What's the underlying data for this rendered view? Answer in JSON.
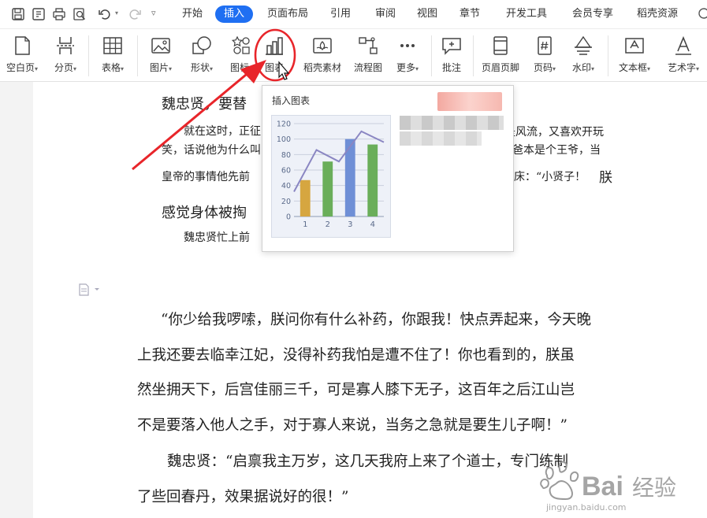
{
  "menubar": {
    "tabs": [
      {
        "label": "开始",
        "active": false
      },
      {
        "label": "插入",
        "active": true
      },
      {
        "label": "页面布局",
        "active": false
      },
      {
        "label": "引用",
        "active": false
      },
      {
        "label": "审阅",
        "active": false
      },
      {
        "label": "视图",
        "active": false
      },
      {
        "label": "章节",
        "active": false
      },
      {
        "label": "开发工具",
        "active": false
      },
      {
        "label": "会员专享",
        "active": false
      },
      {
        "label": "稻壳资源",
        "active": false
      }
    ],
    "quick_icons": [
      "save-icon",
      "export-pdf-icon",
      "print-icon",
      "print-preview-icon",
      "undo-icon",
      "redo-icon",
      "customize-icon"
    ]
  },
  "ribbon": {
    "tools": [
      {
        "label": "空白页",
        "icon": "blank-page-icon",
        "dropdown": true
      },
      {
        "label": "分页",
        "icon": "page-break-icon",
        "dropdown": true
      },
      {
        "label": "表格",
        "icon": "table-icon",
        "dropdown": true
      },
      {
        "label": "图片",
        "icon": "picture-icon",
        "dropdown": true
      },
      {
        "label": "形状",
        "icon": "shape-icon",
        "dropdown": true
      },
      {
        "label": "图标",
        "icon": "icons-icon",
        "dropdown": true
      },
      {
        "label": "图表",
        "icon": "chart-icon",
        "dropdown": false,
        "highlighted": true
      },
      {
        "label": "稻壳素材",
        "icon": "material-icon",
        "dropdown": false
      },
      {
        "label": "流程图",
        "icon": "flowchart-icon",
        "dropdown": false
      },
      {
        "label": "更多",
        "icon": "more-icon",
        "dropdown": true
      },
      {
        "label": "批注",
        "icon": "comment-icon",
        "dropdown": false
      },
      {
        "label": "页眉页脚",
        "icon": "header-footer-icon",
        "dropdown": false
      },
      {
        "label": "页码",
        "icon": "page-number-icon",
        "dropdown": true
      },
      {
        "label": "水印",
        "icon": "watermark-icon",
        "dropdown": true
      },
      {
        "label": "文本框",
        "icon": "textbox-icon",
        "dropdown": true
      },
      {
        "label": "艺术字",
        "icon": "wordart-icon",
        "dropdown": true
      }
    ]
  },
  "popup": {
    "title": "插入图表"
  },
  "chart_data": {
    "type": "bar",
    "categories": [
      "1",
      "2",
      "3",
      "4"
    ],
    "values": [
      47,
      71,
      100,
      93
    ],
    "bar_colors": [
      "#d6a640",
      "#6aae5a",
      "#6f8fd6",
      "#6aae5a"
    ],
    "line_values": [
      32,
      86,
      71,
      110,
      96
    ],
    "line_color": "#8a86c2",
    "yticks": [
      0,
      20,
      40,
      60,
      80,
      100,
      120
    ],
    "ylim": [
      0,
      120
    ],
    "grid": true
  },
  "document": {
    "heading_top": "魏忠贤，要替",
    "small_para": [
      "就在这时，正征",
      "笑，话说他为什么叫",
      "皇帝的事情他先前",
      "感觉身体被掏",
      "魏忠贤忙上前"
    ],
    "right_fragments": [
      "是风流，又喜欢开玩",
      "爸本是个王爷，当",
      "床：“小贤子！",
      "朕"
    ],
    "body_lines": [
      "“你少给我啰嗦，朕问你有什么补药，你跟我！快点弄起来，今天晚",
      "上我还要去临幸江妃，没得补药我怕是遭不住了！你也看到的，朕虽",
      "然坐拥天下，后宫佳丽三千，可是寡人膝下无子，这百年之后江山岂",
      "不是要落入他人之手，对于寡人来说，当务之急就是要生儿子啊！”",
      "魏忠贤：“启禀我主万岁，这几天我府上来了个道士，专门练制",
      "了些回春丹，效果据说好的很！”"
    ]
  },
  "watermark": {
    "brand": "Bai",
    "brand_cn": "经验",
    "domain": "jingyan.baidu.com"
  },
  "colors": {
    "accent": "#1f6ff2",
    "annotation_red": "#e8252a"
  }
}
